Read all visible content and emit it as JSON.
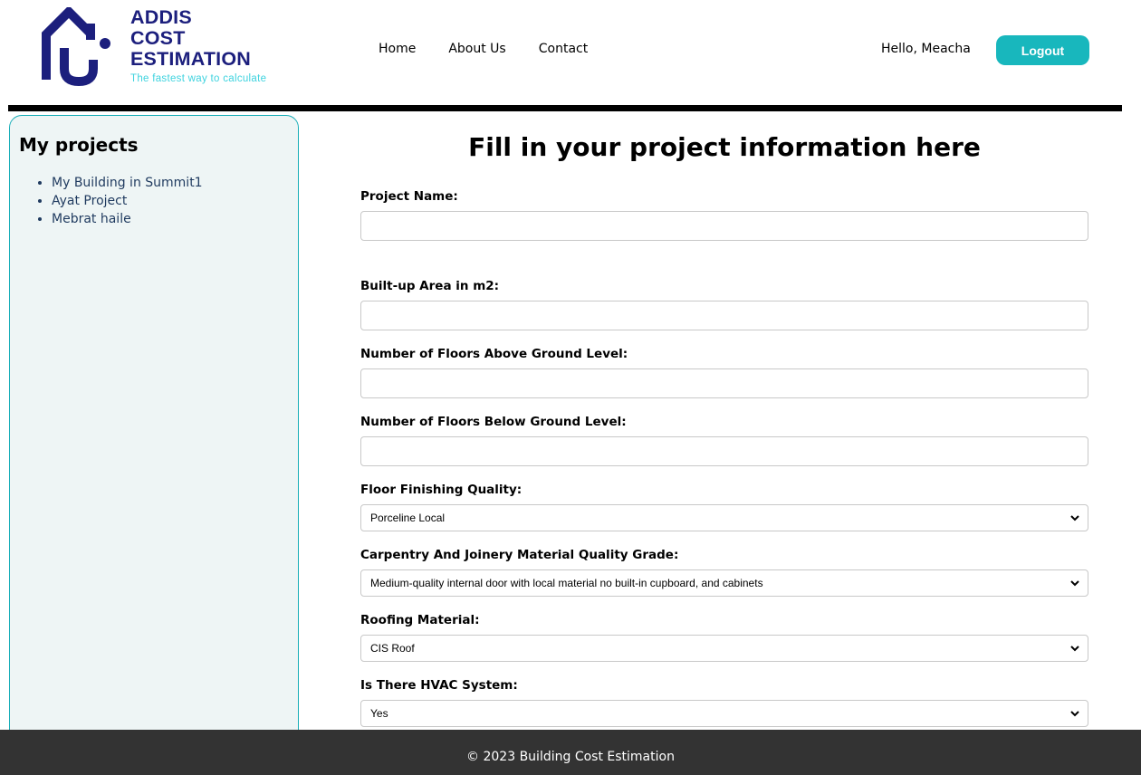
{
  "brand": {
    "line1": "ADDIS",
    "line2": "COST",
    "line3": "ESTIMATION",
    "tagline": "The fastest way to calculate",
    "primary_color": "#1c1f7d",
    "accent_color": "#3fd3df"
  },
  "nav": {
    "items": [
      {
        "label": "Home"
      },
      {
        "label": "About Us"
      },
      {
        "label": "Contact"
      }
    ]
  },
  "user": {
    "greeting": "Hello, Meacha",
    "logout_label": "Logout"
  },
  "sidebar": {
    "title": "My projects",
    "projects": [
      {
        "label": "My Building in Summit1"
      },
      {
        "label": "Ayat Project"
      },
      {
        "label": "Mebrat haile"
      }
    ]
  },
  "form": {
    "title": "Fill in your project information here",
    "fields": {
      "project_name": {
        "label": "Project Name:",
        "value": ""
      },
      "built_up_area": {
        "label": "Built-up Area in m2:",
        "value": ""
      },
      "floors_above": {
        "label": "Number of Floors Above Ground Level:",
        "value": ""
      },
      "floors_below": {
        "label": "Number of Floors Below Ground Level:",
        "value": ""
      },
      "floor_finishing": {
        "label": "Floor Finishing Quality:",
        "selected": "Porceline Local"
      },
      "carpentry": {
        "label": "Carpentry And Joinery Material Quality Grade:",
        "selected": "Medium-quality internal door with local material no built-in cupboard, and cabinets"
      },
      "roofing": {
        "label": "Roofing Material:",
        "selected": "CIS Roof"
      },
      "hvac": {
        "label": "Is There HVAC System:",
        "selected": "Yes"
      }
    }
  },
  "footer": {
    "text": "© 2023 Building Cost Estimation"
  },
  "colors": {
    "logout_button": "#18b7bd",
    "sidebar_bg": "#eef5f5",
    "sidebar_border": "#19aeb8",
    "footer_bg": "#333333"
  }
}
